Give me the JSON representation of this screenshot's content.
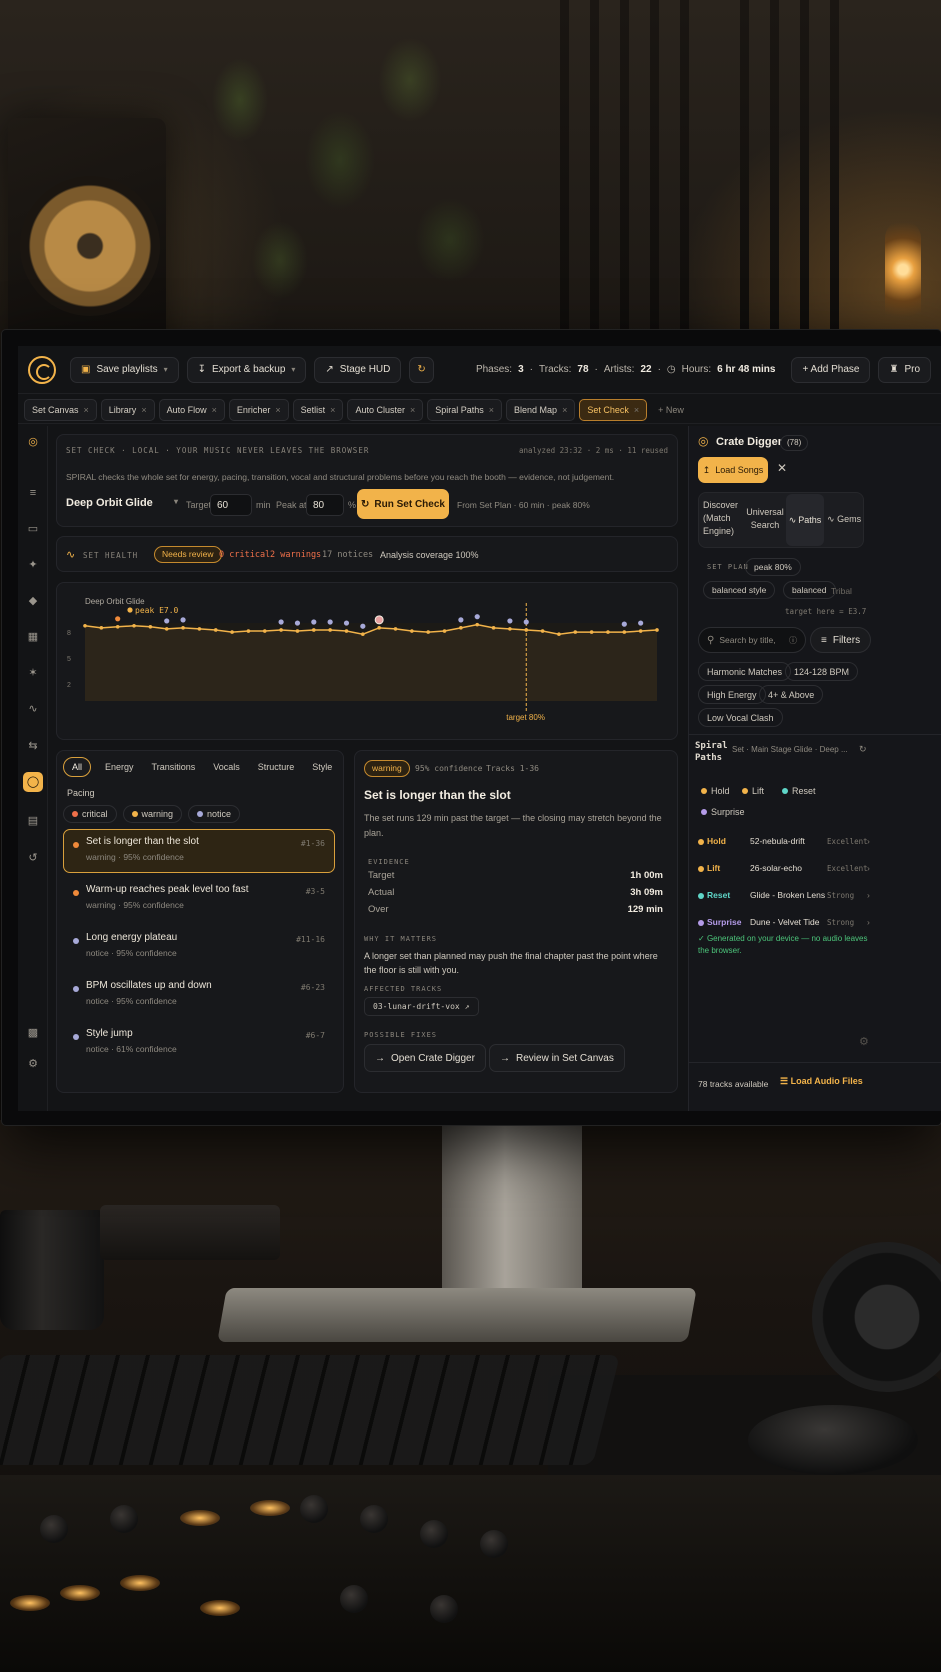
{
  "topbar": {
    "save_playlists": "Save playlists",
    "export_backup": "Export & backup",
    "stage_hud": "Stage HUD",
    "stats": {
      "phases_label": "Phases:",
      "phases": "3",
      "tracks_label": "Tracks:",
      "tracks": "78",
      "artists_label": "Artists:",
      "artists": "22",
      "hours_label": "Hours:",
      "hours": "6 hr 48 mins"
    },
    "add_phase": "+ Add Phase",
    "pro": "Pro"
  },
  "tabs": [
    "Set Canvas",
    "Library",
    "Auto Flow",
    "Enricher",
    "Setlist",
    "Auto Cluster",
    "Spiral Paths",
    "Blend Map",
    "Set Check"
  ],
  "tab_new": "+ New",
  "setcheck": {
    "header": "SET CHECK · LOCAL · YOUR MUSIC NEVER LEAVES THE BROWSER",
    "analyzed": "analyzed 23:32 · 2 ms · 11 reused",
    "description": "SPIRAL checks the whole set for energy, pacing, transition, vocal and structural problems before you reach the booth — evidence, not judgement.",
    "set_name": "Deep Orbit Glide",
    "target_label": "Target",
    "target_value": "60",
    "target_unit": "min",
    "peak_label": "Peak at",
    "peak_value": "80",
    "peak_unit": "%",
    "run_button": "Run Set Check",
    "from_plan": "From Set Plan · 60 min · peak 80%"
  },
  "health": {
    "label": "SET HEALTH",
    "badge": "Needs review",
    "critical": "0 critical",
    "warnings": "2 warnings",
    "notices": "17 notices",
    "coverage": "Analysis coverage 100%"
  },
  "chart_data": {
    "type": "line",
    "title": "Deep Orbit Glide",
    "peak_label": "peak E7.0",
    "target_label": "target 80%",
    "y_ticks": [
      "8",
      "5",
      "2"
    ],
    "ylim": [
      0,
      10
    ],
    "x": [
      1,
      2,
      3,
      4,
      5,
      6,
      7,
      8,
      9,
      10,
      11,
      12,
      13,
      14,
      15,
      16,
      17,
      18,
      19,
      20,
      21,
      22,
      23,
      24,
      25,
      26,
      27,
      28,
      29,
      30,
      31,
      32,
      33,
      34,
      35,
      36
    ],
    "values": [
      7.1,
      6.9,
      7.0,
      7.1,
      7.0,
      6.8,
      6.9,
      6.8,
      6.7,
      6.5,
      6.6,
      6.6,
      6.7,
      6.6,
      6.7,
      6.7,
      6.6,
      6.3,
      6.9,
      6.8,
      6.6,
      6.5,
      6.6,
      6.9,
      7.2,
      6.9,
      6.8,
      6.7,
      6.6,
      6.3,
      6.5,
      6.5,
      6.5,
      6.5,
      6.6,
      6.7
    ],
    "series_color": "#f2b34a",
    "target_x": 28,
    "markers": [
      {
        "x": 3,
        "kind": "peak",
        "color": "#f08a3a"
      },
      {
        "x": 6,
        "kind": "notice",
        "color": "#a7a9d8"
      },
      {
        "x": 7,
        "kind": "notice",
        "color": "#a7a9d8"
      },
      {
        "x": 13,
        "kind": "notice",
        "color": "#a7a9d8"
      },
      {
        "x": 14,
        "kind": "notice",
        "color": "#a7a9d8"
      },
      {
        "x": 15,
        "kind": "notice",
        "color": "#a7a9d8"
      },
      {
        "x": 16,
        "kind": "notice",
        "color": "#a7a9d8"
      },
      {
        "x": 17,
        "kind": "notice",
        "color": "#a7a9d8"
      },
      {
        "x": 18,
        "kind": "notice",
        "color": "#a7a9d8"
      },
      {
        "x": 19,
        "kind": "selected",
        "color": "#e6a0a0"
      },
      {
        "x": 24,
        "kind": "notice",
        "color": "#a7a9d8"
      },
      {
        "x": 25,
        "kind": "notice",
        "color": "#a7a9d8"
      },
      {
        "x": 27,
        "kind": "notice",
        "color": "#a7a9d8"
      },
      {
        "x": 28,
        "kind": "notice",
        "color": "#a7a9d8"
      },
      {
        "x": 34,
        "kind": "notice",
        "color": "#a7a9d8"
      },
      {
        "x": 35,
        "kind": "notice",
        "color": "#a7a9d8"
      }
    ]
  },
  "filters": [
    "All",
    "Energy",
    "Transitions",
    "Vocals",
    "Structure",
    "Style",
    "Pacing"
  ],
  "severity": [
    {
      "label": "critical",
      "color": "#f0704a"
    },
    {
      "label": "warning",
      "color": "#f2b34a"
    },
    {
      "label": "notice",
      "color": "#a7a9d8"
    }
  ],
  "issues": [
    {
      "title": "Set is longer than the slot",
      "meta": "warning  ·  95% confidence",
      "range": "#1-36",
      "color": "#f08a3a"
    },
    {
      "title": "Warm-up reaches peak level too fast",
      "meta": "warning  ·  95% confidence",
      "range": "#3-5",
      "color": "#f08a3a"
    },
    {
      "title": "Long energy plateau",
      "meta": "notice  ·  95% confidence",
      "range": "#11-16",
      "color": "#a7a9d8"
    },
    {
      "title": "BPM oscillates up and down",
      "meta": "notice  ·  95% confidence",
      "range": "#6-23",
      "color": "#a7a9d8"
    },
    {
      "title": "Style jump",
      "meta": "notice  ·  61% confidence",
      "range": "#6-7",
      "color": "#a7a9d8"
    }
  ],
  "detail": {
    "badge": "warning",
    "confidence": "95% confidence",
    "tracks": "Tracks 1-36",
    "title": "Set is longer than the slot",
    "body": "The set runs 129 min past the target — the closing may stretch beyond the plan.",
    "evidence_label": "EVIDENCE",
    "evidence": [
      {
        "k": "Target",
        "v": "1h 00m"
      },
      {
        "k": "Actual",
        "v": "3h 09m"
      },
      {
        "k": "Over",
        "v": "129 min"
      }
    ],
    "why_label": "WHY IT MATTERS",
    "why": "A longer set than planned may push the final chapter past the point where the floor is still with you.",
    "affected_label": "AFFECTED TRACKS",
    "affected": "03-lunar-drift-vox",
    "fixes_label": "POSSIBLE FIXES",
    "fix1": "Open Crate Digger",
    "fix2": "Review in Set Canvas"
  },
  "side": {
    "title": "Crate Digger",
    "count": "(78)",
    "load_songs": "Load Songs",
    "modes": [
      "Discover (Match Engine)",
      "Universal Search",
      "Paths",
      "Gems"
    ],
    "set_plan_label": "SET PLAN",
    "plan_chips": [
      "peak 80%",
      "balanced style",
      "balanced"
    ],
    "tribal": "Tribal",
    "target_here": "target here = E3.7",
    "search_placeholder": "Search by title,",
    "filters": "Filters",
    "tags": [
      "Harmonic Matches",
      "124-128 BPM",
      "High Energy",
      "4+ & Above",
      "Low Vocal Clash"
    ],
    "paths_title": "Spiral Paths",
    "paths_sub": "Set · Main Stage Glide · Deep ...",
    "path_legend": [
      {
        "label": "Hold",
        "color": "#f2b34a"
      },
      {
        "label": "Lift",
        "color": "#f2b34a"
      },
      {
        "label": "Reset",
        "color": "#5fd6c8"
      },
      {
        "label": "Surprise",
        "color": "#b49be8"
      }
    ],
    "path_rows": [
      {
        "kind": "Hold",
        "track": "52-nebula-drift",
        "rating": "Excellent",
        "color": "#f2b34a"
      },
      {
        "kind": "Lift",
        "track": "26-solar-echo",
        "rating": "Excellent",
        "color": "#f2b34a"
      },
      {
        "kind": "Reset",
        "track": "Glide - Broken Lens",
        "rating": "Strong",
        "color": "#5fd6c8"
      },
      {
        "kind": "Surprise",
        "track": "Dune - Velvet Tide",
        "rating": "Strong",
        "color": "#b49be8"
      }
    ],
    "generated": "Generated on your device — no audio leaves the browser.",
    "tracks_available": "78 tracks available",
    "load_audio": "Load Audio Files"
  }
}
